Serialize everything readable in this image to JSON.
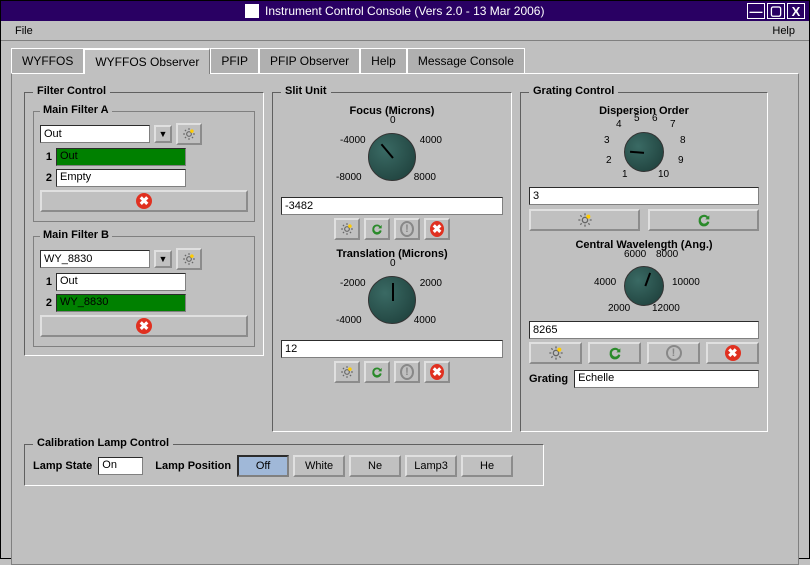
{
  "window": {
    "title": "Instrument Control Console (Vers 2.0 - 13 Mar 2006)"
  },
  "menubar": {
    "file": "File",
    "help": "Help"
  },
  "tabs": {
    "items": [
      "WYFFOS",
      "WYFFOS Observer",
      "PFIP",
      "PFIP Observer",
      "Help",
      "Message Console"
    ],
    "active": 1
  },
  "filter_control": {
    "title": "Filter Control",
    "a": {
      "title": "Main Filter A",
      "select_value": "Out",
      "row1_num": "1",
      "row1_val": "Out",
      "row2_num": "2",
      "row2_val": "Empty"
    },
    "b": {
      "title": "Main Filter B",
      "select_value": "WY_8830",
      "row1_num": "1",
      "row1_val": "Out",
      "row2_num": "2",
      "row2_val": "WY_8830"
    }
  },
  "slit_unit": {
    "title": "Slit Unit",
    "focus": {
      "title": "Focus (Microns)",
      "value": "-3482",
      "ticks": {
        "t0": "0",
        "tn4": "-4000",
        "tp4": "4000",
        "tn8": "-8000",
        "tp8": "8000"
      }
    },
    "trans": {
      "title": "Translation (Microns)",
      "value": "12",
      "ticks": {
        "t0": "0",
        "tn2": "-2000",
        "tp2": "2000",
        "tn4": "-4000",
        "tp4": "4000"
      }
    }
  },
  "grating": {
    "title": "Grating Control",
    "disp": {
      "title": "Dispersion Order",
      "value": "3",
      "ticks": {
        "t1": "1",
        "t2": "2",
        "t3": "3",
        "t4": "4",
        "t5": "5",
        "t6": "6",
        "t7": "7",
        "t8": "8",
        "t9": "9",
        "t10": "10"
      }
    },
    "cwave": {
      "title": "Central Wavelength (Ang.)",
      "value": "8265",
      "ticks": {
        "t2": "2000",
        "t4": "4000",
        "t6": "6000",
        "t8": "8000",
        "t10": "10000",
        "t12": "12000"
      }
    },
    "grating_label": "Grating",
    "grating_value": "Echelle"
  },
  "cal": {
    "title": "Calibration Lamp Control",
    "state_label": "Lamp State",
    "state_value": "On",
    "pos_label": "Lamp Position",
    "buttons": [
      "Off",
      "White",
      "Ne",
      "Lamp3",
      "He"
    ],
    "selected": 0
  }
}
